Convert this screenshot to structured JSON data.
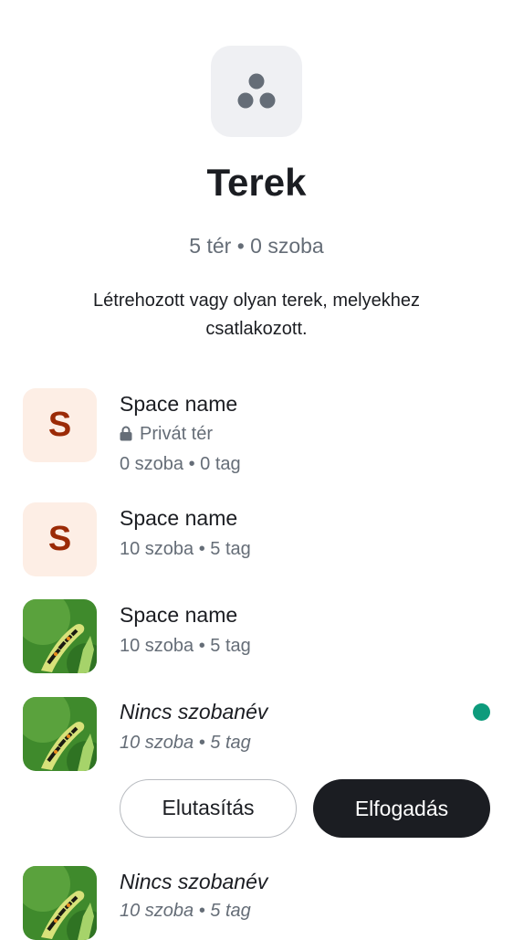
{
  "header": {
    "icon": "spaces-icon",
    "title": "Terek",
    "counts": "5 tér • 0 szoba",
    "description": "Létrehozott vagy olyan terek, melyekhez csatlakozott."
  },
  "spaces": [
    {
      "avatar_letter": "S",
      "name": "Space name",
      "privacy": "Privát tér",
      "meta": "0 szoba • 0 tag"
    },
    {
      "avatar_letter": "S",
      "name": "Space name",
      "meta": "10 szoba • 5 tag"
    },
    {
      "avatar": "caterpillar-photo",
      "name": "Space name",
      "meta": "10 szoba • 5 tag"
    },
    {
      "avatar": "caterpillar-photo",
      "name": "Nincs szobanév",
      "meta": "10 szoba • 5 tag",
      "unread_color": "#0d9b7c",
      "actions": {
        "decline": "Elutasítás",
        "accept": "Elfogadás"
      }
    },
    {
      "avatar": "caterpillar-photo",
      "name": "Nincs szobanév",
      "meta": "10 szoba • 5 tag"
    }
  ],
  "colors": {
    "accent": "#0d9b7c",
    "letter_avatar_bg": "#fdeee5",
    "letter_avatar_fg": "#9b2a06",
    "secondary_text": "#656d77"
  }
}
